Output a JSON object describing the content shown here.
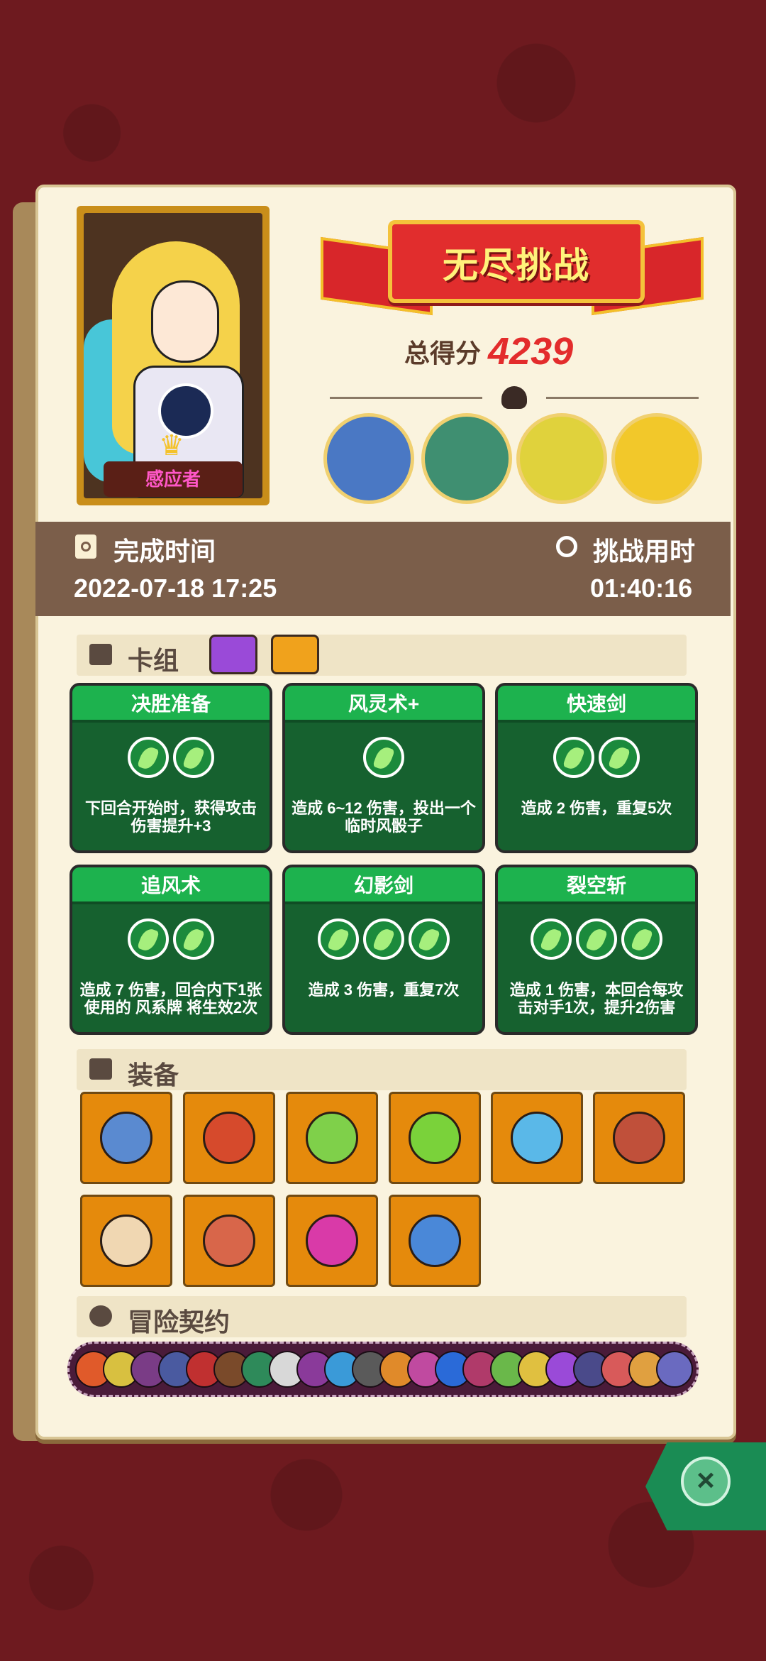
{
  "header": {
    "mode_title": "无尽挑战",
    "score_label": "总得分",
    "score_value": "4239"
  },
  "hero": {
    "name": "感应者"
  },
  "bosses": [
    {
      "icon": "mushroom-elder-icon",
      "color": "#4a78c4"
    },
    {
      "icon": "orc-brute-icon",
      "color": "#3f8f71"
    },
    {
      "icon": "tribal-mask-icon",
      "color": "#e0d23c"
    },
    {
      "icon": "pumpkin-sun-icon",
      "color": "#f2c82a"
    }
  ],
  "stats": {
    "finish_label": "完成时间",
    "finish_value": "2022-07-18 17:25",
    "duration_label": "挑战用时",
    "duration_value": "01:40:16"
  },
  "deck": {
    "title": "卡组",
    "cards": [
      {
        "name": "决胜准备",
        "orbs": 2,
        "desc": "下回合开始时，获得攻击伤害提升+3"
      },
      {
        "name": "风灵术+",
        "orbs": 1,
        "desc": "造成 6~12 伤害，投出一个临时风骰子"
      },
      {
        "name": "快速剑",
        "orbs": 2,
        "desc": "造成 2 伤害，重复5次"
      },
      {
        "name": "追风术",
        "orbs": 2,
        "desc": "造成 7 伤害，回合内下1张使用的 风系牌 将生效2次"
      },
      {
        "name": "幻影剑",
        "orbs": 3,
        "desc": "造成 3 伤害，重复7次"
      },
      {
        "name": "裂空斩",
        "orbs": 3,
        "desc": "造成 1 伤害，本回合每攻击对手1次，提升2伤害"
      }
    ]
  },
  "equipment": {
    "title": "装备",
    "items": [
      {
        "icon": "broken-sword-icon",
        "color": "#5a8ad0"
      },
      {
        "icon": "red-ring-icon",
        "color": "#d64a2c"
      },
      {
        "icon": "green-feather-icon",
        "color": "#7fd04a"
      },
      {
        "icon": "green-potion-icon",
        "color": "#7ad23a"
      },
      {
        "icon": "ice-shield-icon",
        "color": "#5ab8e8"
      },
      {
        "icon": "bronze-disc-icon",
        "color": "#c0503a"
      },
      {
        "icon": "target-shield-icon",
        "color": "#f0d7b2"
      },
      {
        "icon": "meat-leg-icon",
        "color": "#d8664a"
      },
      {
        "icon": "magic-orb-icon",
        "color": "#d93aa8"
      },
      {
        "icon": "blue-mushroom-icon",
        "color": "#4a88d8"
      }
    ]
  },
  "contracts": {
    "title": "冒险契约",
    "icons": [
      "#e05a2a",
      "#d8c040",
      "#7a3c86",
      "#4a5aa0",
      "#c03030",
      "#7a4a2a",
      "#2e8a5a",
      "#d8d8d8",
      "#8a3a9a",
      "#3a9ad8",
      "#5a5a5a",
      "#e08a2a",
      "#c04aa0",
      "#2a6ad8",
      "#b03a6a",
      "#6ab84a",
      "#e0c040",
      "#9a4ad8",
      "#4a4a8a",
      "#d85a5a",
      "#e0a040",
      "#6a6ac0"
    ]
  },
  "close": {
    "icon": "close-icon"
  }
}
